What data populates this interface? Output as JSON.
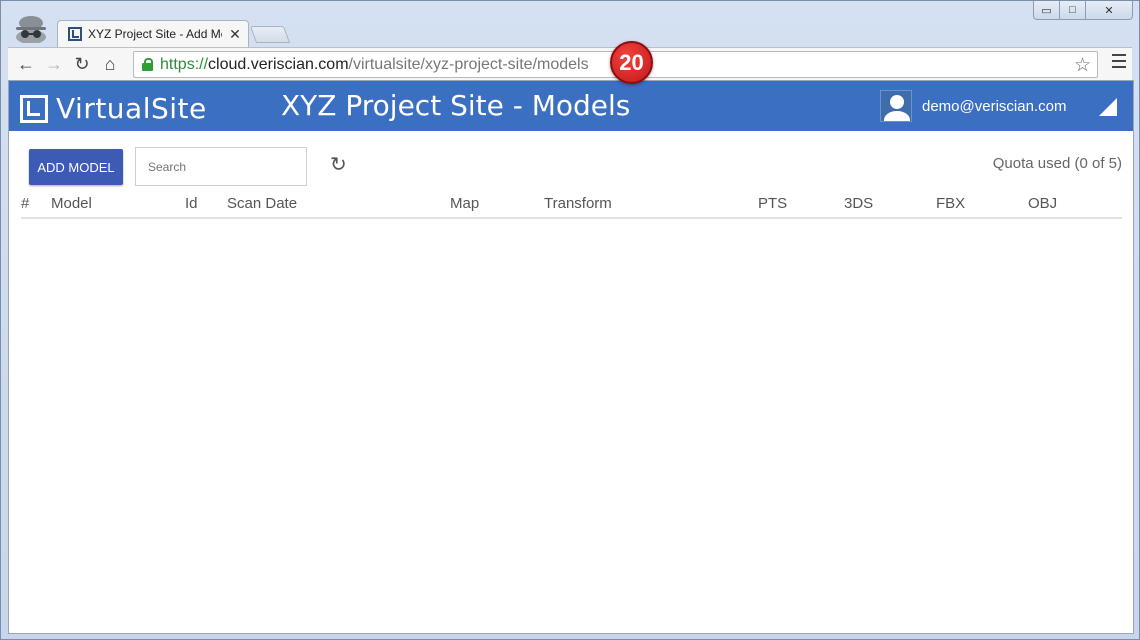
{
  "browser": {
    "tab_title": "XYZ Project Site - Add Mc",
    "tab_close": "✕",
    "url_scheme": "https://",
    "url_host": "cloud.veriscian.com",
    "url_path": "/virtualsite/xyz-project-site/models",
    "back_icon": "←",
    "forward_icon": "→",
    "reload_icon": "↻",
    "home_icon": "⌂",
    "bookmark_icon": "☆",
    "window_min": "▭",
    "window_max": "□",
    "window_close": "✕"
  },
  "annotation": {
    "step_number": "20"
  },
  "app": {
    "logo_text": "VirtualSite",
    "title": "XYZ Project Site - Models",
    "user_email": "demo@veriscian.com",
    "brand_color": "#3b6fc1"
  },
  "controls": {
    "add_button": "ADD MODEL",
    "search_placeholder": "Search",
    "refresh_icon": "↻",
    "quota_text": "Quota used (0 of 5)"
  },
  "table": {
    "columns": [
      "#",
      "Model",
      "Id",
      "Scan Date",
      "Map",
      "Transform",
      "PTS",
      "3DS",
      "FBX",
      "OBJ"
    ],
    "rows": []
  }
}
